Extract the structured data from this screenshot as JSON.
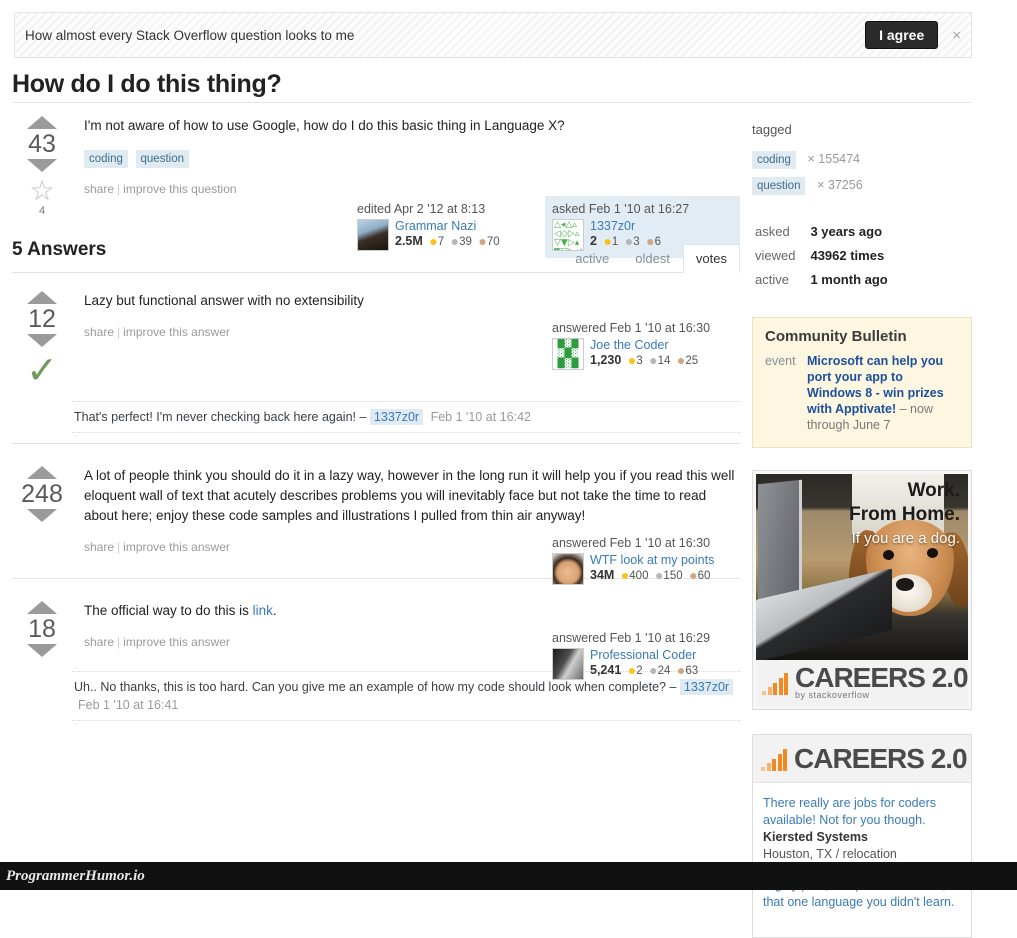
{
  "notice": {
    "text": "How almost every Stack Overflow question looks to me",
    "agree_label": "I agree",
    "close_icon": "close-icon",
    "close_glyph": "×"
  },
  "question": {
    "title": "How do I do this thing?",
    "score": "43",
    "favorite_count": "4",
    "body": "I'm not aware of how to use Google, how do I do this basic thing in Language X?",
    "tags": [
      "coding",
      "question"
    ],
    "menu": {
      "share": "share",
      "improve": "improve this question"
    },
    "edited": {
      "action": "edited Apr 2 '12 at 8:13",
      "user": "Grammar Nazi",
      "rep": "2.5M",
      "gold": "7",
      "silver": "39",
      "bronze": "70"
    },
    "asked": {
      "action": "asked Feb 1 '10 at 16:27",
      "user": "1337z0r",
      "rep": "2",
      "gold": "1",
      "silver": "3",
      "bronze": "6"
    }
  },
  "answers_header": {
    "count_label": "5 Answers",
    "tabs": [
      {
        "label": "active",
        "active": false
      },
      {
        "label": "oldest",
        "active": false
      },
      {
        "label": "votes",
        "active": true
      }
    ]
  },
  "answers": [
    {
      "score": "12",
      "accepted": true,
      "accepted_icon": "check-icon",
      "body": "Lazy but functional answer with no extensibility",
      "menu": {
        "share": "share",
        "improve": "improve this answer"
      },
      "signature": {
        "action": "answered Feb 1 '10 at 16:30",
        "user": "Joe the Coder",
        "rep": "1,230",
        "gold": "3",
        "silver": "14",
        "bronze": "25"
      },
      "comments": [
        {
          "text": "That's perfect! I'm never checking back here again! –",
          "user": "1337z0r",
          "date": "Feb 1 '10 at 16:42"
        }
      ]
    },
    {
      "score": "248",
      "accepted": false,
      "body": "A lot of people think you should do it in a lazy way, however in the long run it will help you if you read this well eloquent wall of text that acutely describes problems you will inevitably face but not take the time to read about here; enjoy these code samples and illustrations I pulled from thin air anyway!",
      "menu": {
        "share": "share",
        "improve": "improve this answer"
      },
      "signature": {
        "action": "answered Feb 1 '10 at 16:30",
        "user": "WTF look at my points",
        "rep": "34M",
        "gold": "400",
        "silver": "150",
        "bronze": "60"
      },
      "comments": []
    },
    {
      "score": "18",
      "accepted": false,
      "body_prefix": "The official way to do this is ",
      "body_link": "link",
      "body_suffix": ".",
      "menu": {
        "share": "share",
        "improve": "improve this answer"
      },
      "signature": {
        "action": "answered Feb 1 '10 at 16:29",
        "user": "Professional Coder",
        "rep": "5,241",
        "gold": "2",
        "silver": "24",
        "bronze": "63"
      },
      "comments": [
        {
          "text": "Uh.. No thanks, this is too hard. Can you give me an example of how my code should look when complete? –",
          "user": "1337z0r",
          "date": "Feb 1 '10 at 16:41"
        }
      ]
    }
  ],
  "sidebar": {
    "tagged_label": "tagged",
    "tags": [
      {
        "name": "coding",
        "count": "× 155474"
      },
      {
        "name": "question",
        "count": "× 37256"
      }
    ],
    "stats": [
      {
        "label": "asked",
        "value": "3 years ago"
      },
      {
        "label": "viewed",
        "value": "43962 times"
      },
      {
        "label": "active",
        "value": "1 month ago"
      }
    ],
    "bulletin": {
      "title": "Community Bulletin",
      "kind": "event",
      "link": "Microsoft can help you port your app to Windows 8 - win prizes with Apptivate!",
      "note": "– now through June 7"
    },
    "ad": {
      "line1": "Work.",
      "line2": "From Home.",
      "line3": "If you are a dog.",
      "brand": "CAREERS 2.0",
      "brand_sub": "by stackoverflow",
      "photo_alt": "dog-at-laptop-photo"
    },
    "jobs": {
      "brand": "CAREERS 2.0",
      "items": [
        {
          "title": "There really are jobs for coders available! Not for you though.",
          "company": "Kiersted Systems",
          "location": "Houston, TX / relocation"
        },
        {
          "title": "Highly paid, competitive benefits; that one language you didn't learn.",
          "company": "",
          "location": ""
        }
      ]
    }
  },
  "watermark": {
    "text": "ProgrammerHumor.io"
  },
  "colors": {
    "accent_link": "#3a7ab5",
    "tag_bg": "#e0eaf1",
    "tag_fg": "#3e6d8e",
    "highlight_bg": "#e1ecf4",
    "bulletin_bg": "#fdf7e2",
    "accepted_green": "#6f9c5b",
    "gold": "#fcc21b",
    "silver": "#b4b8bc",
    "bronze": "#d1a684",
    "careers_orange": "#f18a21"
  }
}
